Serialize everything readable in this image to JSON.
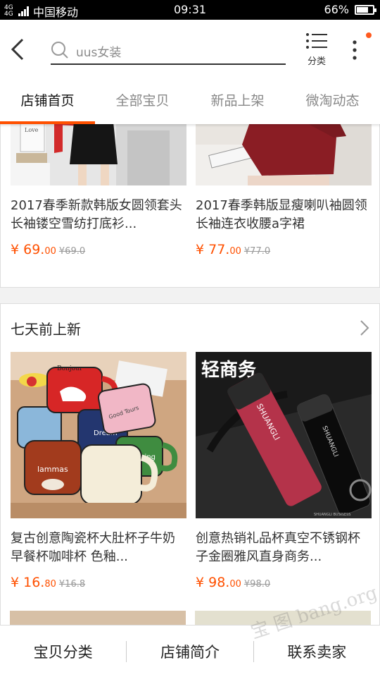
{
  "status_bar": {
    "network": "4G 4G",
    "carrier": "中国移动",
    "time": "09:31",
    "battery": "66%",
    "battery_level": 0.66
  },
  "header": {
    "search_placeholder": "uus女装",
    "category_label": "分类"
  },
  "tabs": [
    {
      "label": "店铺首页",
      "active": true
    },
    {
      "label": "全部宝贝",
      "active": false
    },
    {
      "label": "新品上架",
      "active": false
    },
    {
      "label": "微淘动态",
      "active": false
    }
  ],
  "section1": {
    "products": [
      {
        "title": "2017春季新款韩版女圆领套头长袖镂空雪纺打底衫...",
        "price_main": "¥ 69.",
        "price_cents": "00",
        "old_price": "¥69.0"
      },
      {
        "title": "2017春季韩版显瘦喇叭袖圆领长袖连衣收腰a字裙",
        "price_main": "¥ 77.",
        "price_cents": "00",
        "old_price": "¥77.0"
      }
    ]
  },
  "section2": {
    "title": "七天前上新",
    "products": [
      {
        "title": "复古创意陶瓷杯大肚杯子牛奶早餐杯咖啡杯 色釉...",
        "price_main": "¥ 16.",
        "price_cents": "80",
        "old_price": "¥16.8",
        "image_text": [
          "lammas",
          "Dream",
          "Good Tours",
          "Making"
        ]
      },
      {
        "title": "创意热销礼品杯真空不锈钢杯子金圈雅风直身商务...",
        "price_main": "¥ 98.",
        "price_cents": "00",
        "old_price": "¥98.0",
        "image_text": [
          "轻商务",
          "SHUANGLI",
          "SHUANGLI BUSINESS"
        ]
      }
    ]
  },
  "bottom_bar": [
    "宝贝分类",
    "店铺简介",
    "联系卖家"
  ],
  "watermark": "宝 图 bang.org",
  "colors": {
    "accent": "#ff5000",
    "price": "#ff5000"
  }
}
